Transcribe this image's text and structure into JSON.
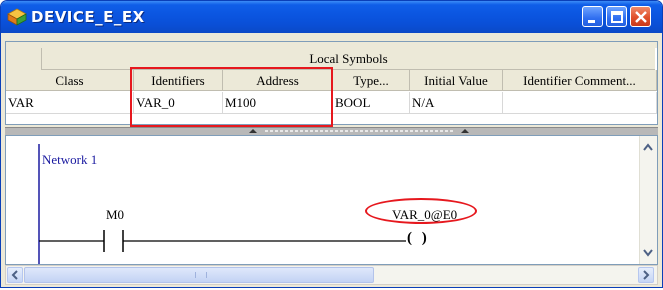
{
  "window": {
    "title": "DEVICE_E_EX"
  },
  "symbols": {
    "group_header": "Local Symbols",
    "columns": [
      "Class",
      "Identifiers",
      "Address",
      "Type...",
      "Initial Value",
      "Identifier Comment..."
    ],
    "rows": [
      {
        "class": "VAR",
        "identifier": "VAR_0",
        "address": "M100",
        "type": "BOOL",
        "initial_value": "N/A",
        "comment": ""
      }
    ]
  },
  "ladder": {
    "network_label": "Network 1",
    "contact_label": "M0",
    "coil_label": "VAR_0@E0",
    "coil_symbol": "( )"
  },
  "colors": {
    "title_bar": "#0a55e0",
    "highlight": "#e6181e",
    "network_text": "#1a1aa0"
  },
  "icons": [
    "app-icon",
    "minimize-icon",
    "maximize-icon",
    "close-icon",
    "scroll-up-icon",
    "scroll-down-icon",
    "scroll-left-icon",
    "scroll-right-icon"
  ]
}
